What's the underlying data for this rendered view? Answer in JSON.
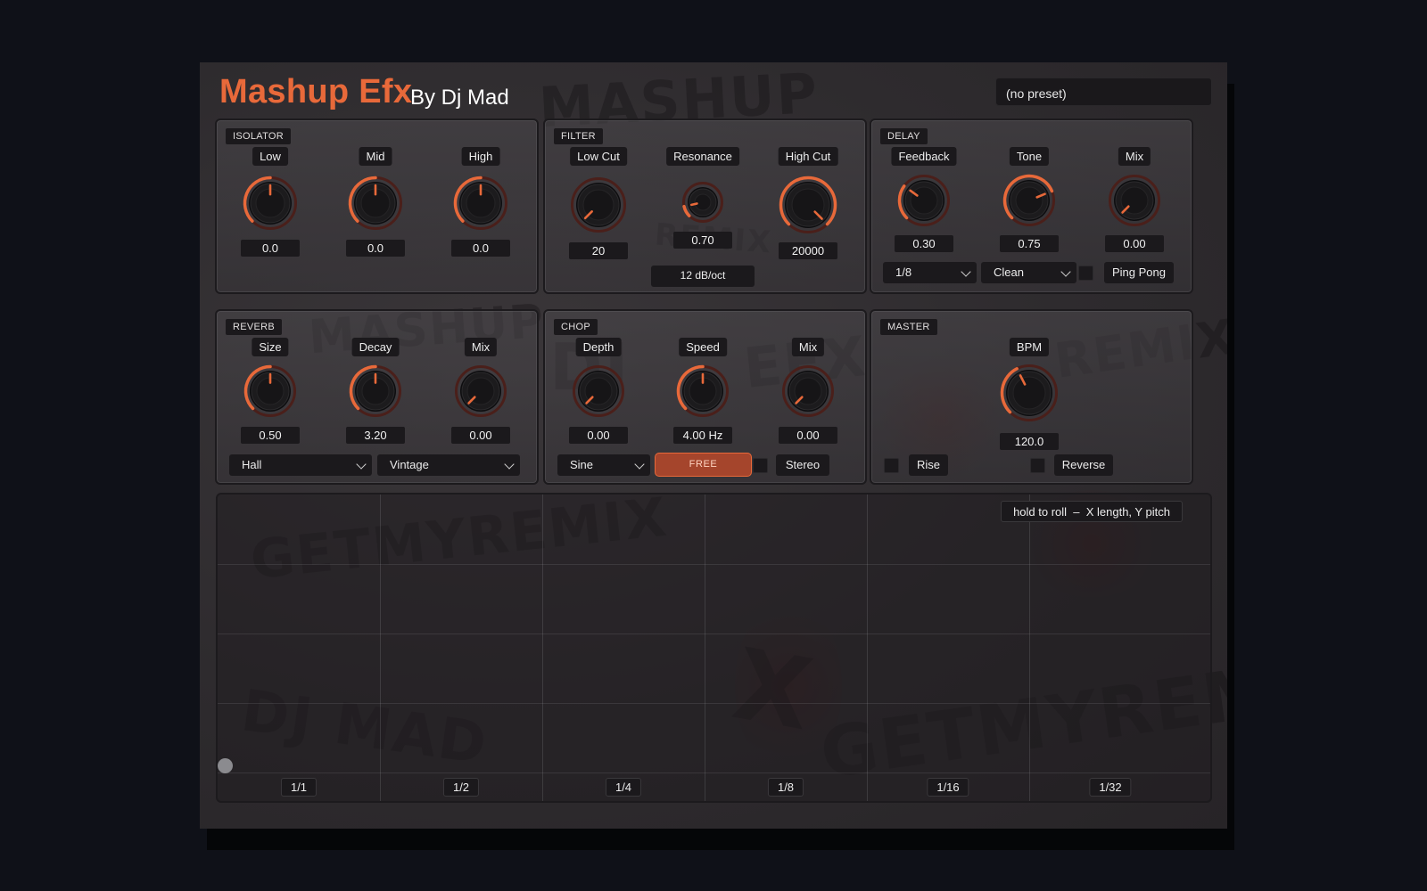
{
  "app": {
    "title": "Mashup Efx",
    "subtitle": "By Dj Mad",
    "preset": "(no preset)"
  },
  "colors": {
    "accent": "#e8693a",
    "panel_label_bg": "#1b191c",
    "background": "#0f1118"
  },
  "graffiti": [
    "MASHUP",
    "REMIX",
    "MASHUP",
    "DJ",
    "EFX",
    "REMIX",
    "GETMYREMIX",
    "DJ MAD",
    "GETMYREMIX",
    "X"
  ],
  "isolator": {
    "title": "ISOLATOR",
    "knobs": [
      {
        "label": "Low",
        "value": "0.0",
        "norm": 0.5
      },
      {
        "label": "Mid",
        "value": "0.0",
        "norm": 0.5
      },
      {
        "label": "High",
        "value": "0.0",
        "norm": 0.5
      }
    ]
  },
  "filter": {
    "title": "FILTER",
    "knobs": [
      {
        "label": "Low Cut",
        "value": "20",
        "norm": 0.0
      },
      {
        "label": "Resonance",
        "value": "0.70",
        "norm": 0.12
      },
      {
        "label": "High Cut",
        "value": "20000",
        "norm": 1.0
      }
    ],
    "slope": "12 dB/oct"
  },
  "delay": {
    "title": "DELAY",
    "knobs": [
      {
        "label": "Feedback",
        "value": "0.30",
        "norm": 0.3
      },
      {
        "label": "Tone",
        "value": "0.75",
        "norm": 0.75
      },
      {
        "label": "Mix",
        "value": "0.00",
        "norm": 0.0
      }
    ],
    "time": "1/8",
    "mode": "Clean",
    "pingpong_label": "Ping Pong",
    "pingpong": false
  },
  "reverb": {
    "title": "REVERB",
    "knobs": [
      {
        "label": "Size",
        "value": "0.50",
        "norm": 0.5
      },
      {
        "label": "Decay",
        "value": "3.20",
        "norm": 0.5
      },
      {
        "label": "Mix",
        "value": "0.00",
        "norm": 0.0
      }
    ],
    "type": "Hall",
    "character": "Vintage"
  },
  "chop": {
    "title": "CHOP",
    "knobs": [
      {
        "label": "Depth",
        "value": "0.00",
        "norm": 0.0
      },
      {
        "label": "Speed",
        "value": "4.00 Hz",
        "norm": 0.5
      },
      {
        "label": "Mix",
        "value": "0.00",
        "norm": 0.0
      }
    ],
    "shape": "Sine",
    "sync_label": "FREE",
    "stereo_label": "Stereo",
    "stereo": false
  },
  "master": {
    "title": "MASTER",
    "knobs": [
      {
        "label": "BPM",
        "value": "120.0",
        "norm": 0.4
      }
    ],
    "rise_label": "Rise",
    "reverse_label": "Reverse",
    "rise": false,
    "reverse": false
  },
  "roll_pad": {
    "hint": "hold to roll  –  X length, Y pitch",
    "divisions": [
      "1/1",
      "1/2",
      "1/4",
      "1/8",
      "1/16",
      "1/32"
    ]
  }
}
